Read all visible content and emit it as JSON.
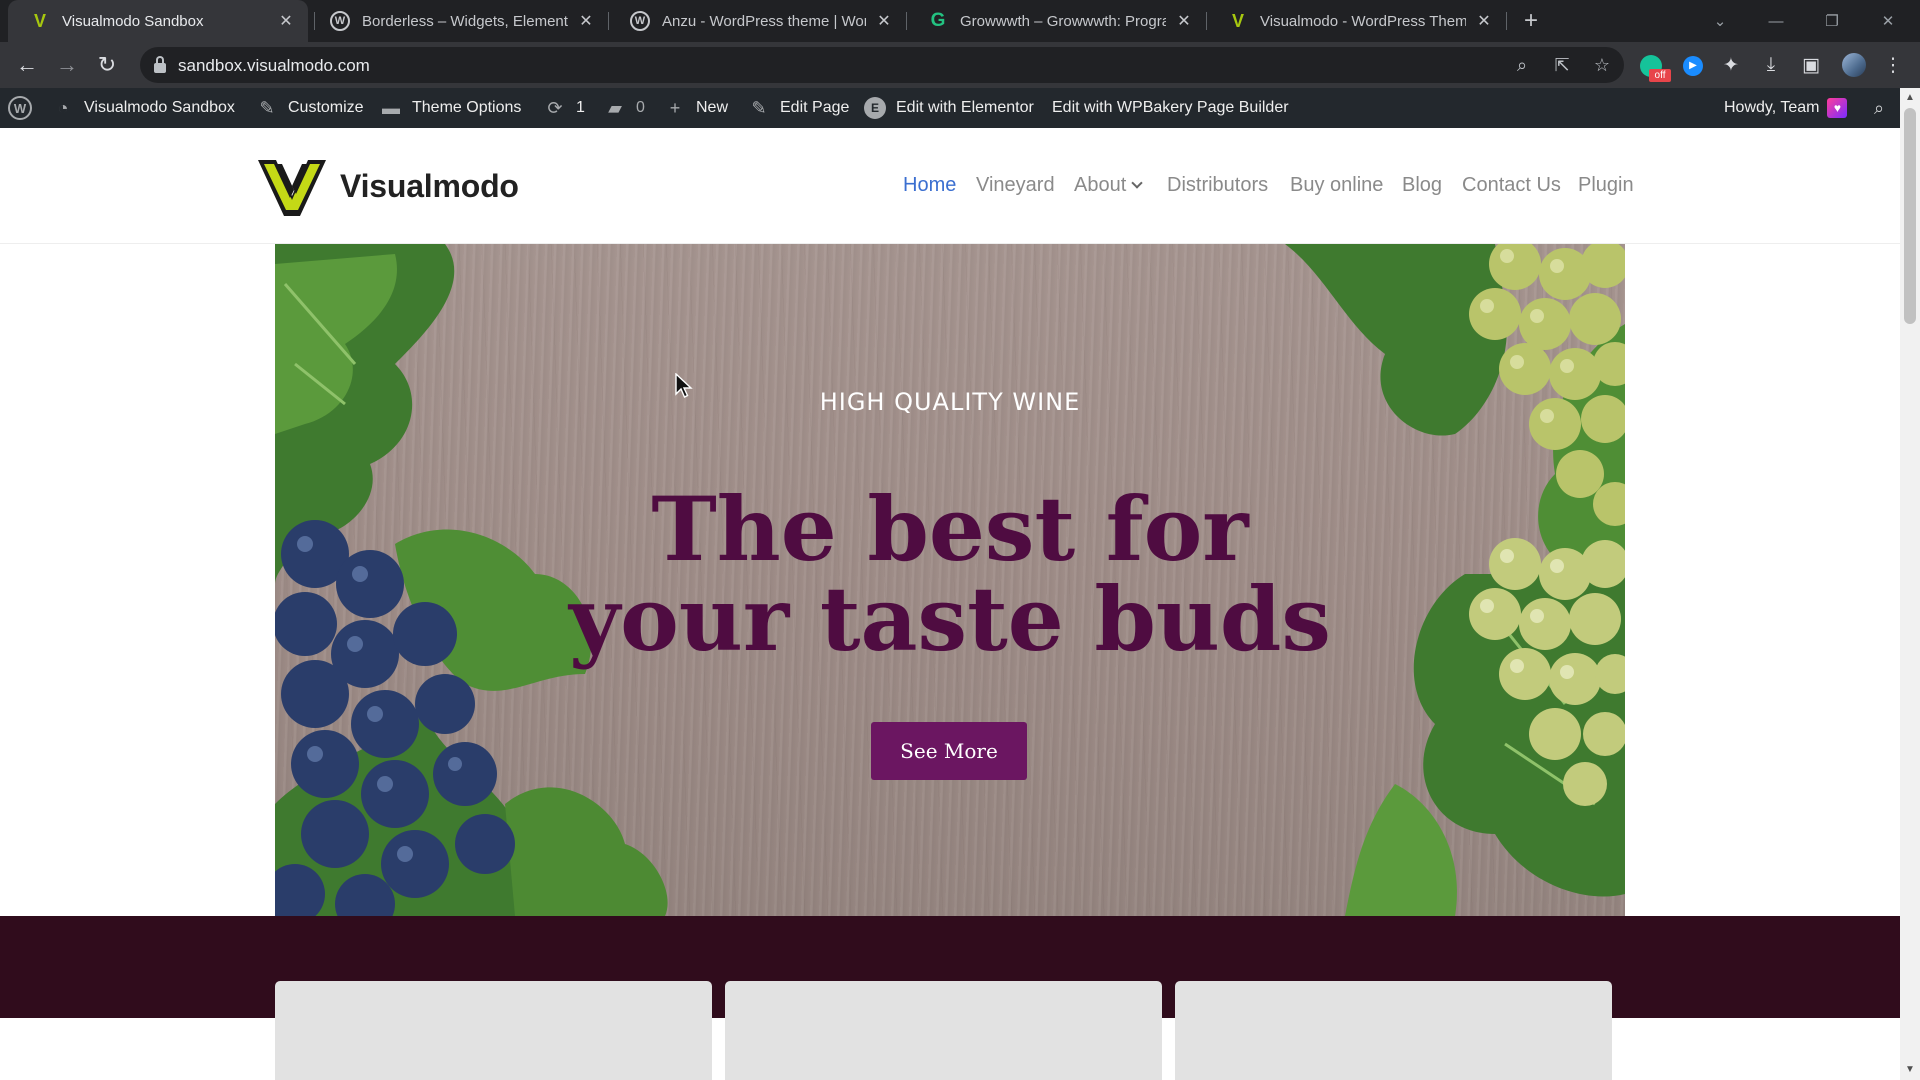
{
  "browser": {
    "tabs": [
      {
        "title": "Visualmodo Sandbox",
        "favicon": "visualmodo-favicon",
        "active": true
      },
      {
        "title": "Borderless – Widgets, Elements, T",
        "favicon": "wordpress-favicon",
        "active": false
      },
      {
        "title": "Anzu - WordPress theme | WordP",
        "favicon": "wordpress-favicon",
        "active": false
      },
      {
        "title": "Growwwth – Growwwth: Program",
        "favicon": "growwwth-favicon",
        "active": false
      },
      {
        "title": "Visualmodo - WordPress Themes",
        "favicon": "visualmodo-favicon",
        "active": false
      }
    ],
    "address": "sandbox.visualmodo.com",
    "extension_badge": "off"
  },
  "admin_bar": {
    "site_name": "Visualmodo Sandbox",
    "customize": "Customize",
    "theme_options": "Theme Options",
    "updates_count": "1",
    "comments_count": "0",
    "new": "New",
    "edit_page": "Edit Page",
    "edit_elementor": "Edit with Elementor",
    "edit_wpbakery": "Edit with WPBakery Page Builder",
    "howdy": "Howdy, Team"
  },
  "site": {
    "logo_text": "Visualmodo",
    "nav": [
      {
        "label": "Home",
        "active": true
      },
      {
        "label": "Vineyard"
      },
      {
        "label": "About"
      },
      {
        "label": "Distributors"
      },
      {
        "label": "Buy online"
      },
      {
        "label": "Blog"
      },
      {
        "label": "Contact Us"
      },
      {
        "label": "Plugin"
      }
    ]
  },
  "hero": {
    "kicker": "HIGH QUALITY WINE",
    "title_line1": "The best for",
    "title_line2": "your taste buds",
    "button_label": "See More"
  },
  "colors": {
    "accent_nav": "#3b6fd0",
    "hero_title": "#4f0c41",
    "hero_button": "#6b1661",
    "band": "#300c1c",
    "admin_bar": "#23282d",
    "logo_lime": "#c4d916"
  }
}
